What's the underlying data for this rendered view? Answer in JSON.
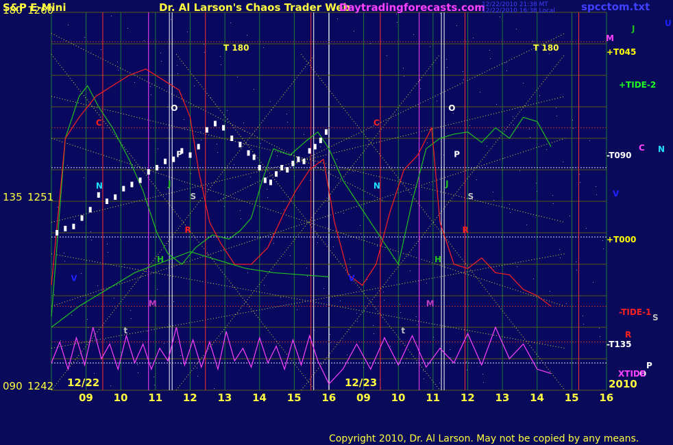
{
  "chart_data": {
    "type": "line",
    "title_left": "S&P E-Mini",
    "title_center": "Dr. Al Larson's Chaos Trader Web",
    "title_site": "Daytradingforecasts.com",
    "timestamp_1": "12/22/2010 21:38 MT",
    "timestamp_2": "12/22/2010 16:38 Local",
    "filename": "spcctom.txt",
    "copyright": "Copyright 2010, Dr. Al Larson. May not be copied by any means.",
    "y_axis": {
      "range": [
        1242,
        1260
      ],
      "labels": [
        {
          "angle": "180",
          "price": "1260",
          "value": 1260
        },
        {
          "angle": "135",
          "price": "1251",
          "value": 1251
        },
        {
          "angle": "090",
          "price": "1242",
          "value": 1242
        }
      ]
    },
    "x_axis": {
      "session_1_ticks": [
        "09",
        "10",
        "11",
        "12",
        "13",
        "14",
        "15",
        "16"
      ],
      "session_2_ticks": [
        "09",
        "10",
        "11",
        "12",
        "13",
        "14",
        "15",
        "16"
      ],
      "date_1": "12/22",
      "date_2": "12/23",
      "year": "2010"
    },
    "right_labels": [
      {
        "text": "M",
        "color": "#ff40ff"
      },
      {
        "text": "J",
        "color": "#20c020"
      },
      {
        "text": "U",
        "color": "#2020ff"
      },
      {
        "text": "+T045",
        "color": "#ffff00"
      },
      {
        "text": "+TIDE-2",
        "color": "#20ff20"
      },
      {
        "text": "C",
        "color": "#ff40ff"
      },
      {
        "text": "N",
        "color": "#20e0ff"
      },
      {
        "text": "-T090",
        "color": "#ffffff"
      },
      {
        "text": "V",
        "color": "#2020ff"
      },
      {
        "text": "+T000",
        "color": "#ffff00"
      },
      {
        "text": "-TIDE-1",
        "color": "#ff2020"
      },
      {
        "text": "S",
        "color": "#c0c0c0"
      },
      {
        "text": "R",
        "color": "#ff2020"
      },
      {
        "text": "-T135",
        "color": "#ffffff"
      },
      {
        "text": "P",
        "color": "#ffffff"
      },
      {
        "text": "O",
        "color": "#ffffff"
      },
      {
        "text": "XTIDE",
        "color": "#ff40ff"
      }
    ],
    "t180_label": "T   180",
    "price_bars": [
      {
        "x": 0.02,
        "y": 1249.5
      },
      {
        "x": 0.05,
        "y": 1249.7
      },
      {
        "x": 0.08,
        "y": 1249.8
      },
      {
        "x": 0.11,
        "y": 1250.2
      },
      {
        "x": 0.14,
        "y": 1250.6
      },
      {
        "x": 0.17,
        "y": 1251.3
      },
      {
        "x": 0.2,
        "y": 1251.0
      },
      {
        "x": 0.23,
        "y": 1251.2
      },
      {
        "x": 0.26,
        "y": 1251.6
      },
      {
        "x": 0.29,
        "y": 1251.8
      },
      {
        "x": 0.32,
        "y": 1252.0
      },
      {
        "x": 0.35,
        "y": 1252.4
      },
      {
        "x": 0.38,
        "y": 1252.6
      },
      {
        "x": 0.41,
        "y": 1252.9
      },
      {
        "x": 0.44,
        "y": 1253.0
      },
      {
        "x": 0.47,
        "y": 1253.4
      },
      {
        "x": 0.5,
        "y": 1253.2
      },
      {
        "x": 0.53,
        "y": 1253.6
      },
      {
        "x": 0.56,
        "y": 1254.4
      },
      {
        "x": 0.59,
        "y": 1254.7
      },
      {
        "x": 0.62,
        "y": 1254.5
      },
      {
        "x": 0.65,
        "y": 1254.0
      },
      {
        "x": 0.68,
        "y": 1253.7
      },
      {
        "x": 0.71,
        "y": 1253.3
      },
      {
        "x": 0.73,
        "y": 1253.1
      },
      {
        "x": 0.75,
        "y": 1252.6
      },
      {
        "x": 0.77,
        "y": 1252.0
      },
      {
        "x": 0.79,
        "y": 1251.9
      },
      {
        "x": 0.81,
        "y": 1252.3
      },
      {
        "x": 0.83,
        "y": 1252.6
      },
      {
        "x": 0.85,
        "y": 1252.5
      },
      {
        "x": 0.87,
        "y": 1252.8
      },
      {
        "x": 0.89,
        "y": 1253.0
      },
      {
        "x": 0.91,
        "y": 1252.9
      },
      {
        "x": 0.93,
        "y": 1253.4
      },
      {
        "x": 0.95,
        "y": 1253.6
      },
      {
        "x": 0.97,
        "y": 1253.9
      },
      {
        "x": 0.99,
        "y": 1254.3
      }
    ],
    "series": [
      {
        "color": "#20c020",
        "points": [
          [
            0.0,
            1245.5
          ],
          [
            0.05,
            1254.0
          ],
          [
            0.1,
            1256.0
          ],
          [
            0.13,
            1256.5
          ],
          [
            0.17,
            1255.5
          ],
          [
            0.22,
            1254.5
          ],
          [
            0.28,
            1253.0
          ],
          [
            0.33,
            1251.5
          ],
          [
            0.38,
            1249.5
          ],
          [
            0.42,
            1248.5
          ],
          [
            0.47,
            1248.0
          ],
          [
            0.52,
            1248.8
          ],
          [
            0.58,
            1249.4
          ],
          [
            0.64,
            1249.2
          ],
          [
            0.68,
            1249.6
          ],
          [
            0.72,
            1250.2
          ],
          [
            0.76,
            1252.0
          ],
          [
            0.8,
            1253.5
          ],
          [
            0.86,
            1253.2
          ],
          [
            0.92,
            1253.9
          ],
          [
            0.96,
            1254.3
          ],
          [
            1.0,
            1253.5
          ],
          [
            1.05,
            1252.0
          ],
          [
            1.1,
            1251.0
          ],
          [
            1.15,
            1250.0
          ],
          [
            1.2,
            1249.0
          ],
          [
            1.25,
            1248.0
          ],
          [
            1.3,
            1251.0
          ],
          [
            1.35,
            1253.5
          ],
          [
            1.4,
            1254.0
          ],
          [
            1.45,
            1254.2
          ],
          [
            1.5,
            1254.3
          ],
          [
            1.55,
            1253.8
          ],
          [
            1.6,
            1254.5
          ],
          [
            1.65,
            1254.0
          ],
          [
            1.7,
            1255.0
          ],
          [
            1.75,
            1254.8
          ],
          [
            1.8,
            1253.6
          ]
        ]
      },
      {
        "color": "#ff2020",
        "points": [
          [
            0.0,
            1247.0
          ],
          [
            0.05,
            1254.0
          ],
          [
            0.1,
            1255.0
          ],
          [
            0.16,
            1256.0
          ],
          [
            0.22,
            1256.5
          ],
          [
            0.28,
            1257.0
          ],
          [
            0.34,
            1257.3
          ],
          [
            0.4,
            1256.8
          ],
          [
            0.46,
            1256.3
          ],
          [
            0.5,
            1255.0
          ],
          [
            0.53,
            1252.5
          ],
          [
            0.57,
            1250.0
          ],
          [
            0.61,
            1249.0
          ],
          [
            0.66,
            1248.0
          ],
          [
            0.72,
            1248.0
          ],
          [
            0.78,
            1248.8
          ],
          [
            0.84,
            1250.5
          ],
          [
            0.88,
            1251.5
          ],
          [
            0.93,
            1252.5
          ],
          [
            0.98,
            1253.0
          ],
          [
            1.02,
            1250.0
          ],
          [
            1.07,
            1247.5
          ],
          [
            1.12,
            1247.0
          ],
          [
            1.17,
            1248.0
          ],
          [
            1.22,
            1250.5
          ],
          [
            1.27,
            1252.5
          ],
          [
            1.32,
            1253.2
          ],
          [
            1.37,
            1254.5
          ],
          [
            1.4,
            1250.0
          ],
          [
            1.45,
            1248.0
          ],
          [
            1.5,
            1247.8
          ],
          [
            1.55,
            1248.3
          ],
          [
            1.6,
            1247.6
          ],
          [
            1.65,
            1247.5
          ],
          [
            1.7,
            1246.8
          ],
          [
            1.75,
            1246.5
          ],
          [
            1.8,
            1246.0
          ]
        ]
      },
      {
        "color": "#ff40ff",
        "points": [
          [
            0.0,
            1243.3
          ],
          [
            0.03,
            1244.3
          ],
          [
            0.06,
            1243.0
          ],
          [
            0.09,
            1244.5
          ],
          [
            0.12,
            1243.2
          ],
          [
            0.15,
            1245.0
          ],
          [
            0.18,
            1243.5
          ],
          [
            0.21,
            1244.2
          ],
          [
            0.24,
            1243.0
          ],
          [
            0.27,
            1244.6
          ],
          [
            0.3,
            1243.3
          ],
          [
            0.33,
            1244.2
          ],
          [
            0.36,
            1243.0
          ],
          [
            0.39,
            1244.0
          ],
          [
            0.42,
            1243.4
          ],
          [
            0.45,
            1245.0
          ],
          [
            0.48,
            1243.2
          ],
          [
            0.51,
            1244.4
          ],
          [
            0.54,
            1243.1
          ],
          [
            0.57,
            1244.3
          ],
          [
            0.6,
            1243.0
          ],
          [
            0.63,
            1244.8
          ],
          [
            0.66,
            1243.4
          ],
          [
            0.69,
            1244.0
          ],
          [
            0.72,
            1243.1
          ],
          [
            0.75,
            1244.5
          ],
          [
            0.78,
            1243.3
          ],
          [
            0.81,
            1244.1
          ],
          [
            0.84,
            1243.0
          ],
          [
            0.87,
            1244.4
          ],
          [
            0.9,
            1243.2
          ],
          [
            0.93,
            1244.6
          ],
          [
            0.96,
            1243.4
          ],
          [
            1.0,
            1242.3
          ],
          [
            1.05,
            1243.0
          ],
          [
            1.1,
            1244.2
          ],
          [
            1.15,
            1243.0
          ],
          [
            1.2,
            1244.5
          ],
          [
            1.25,
            1243.2
          ],
          [
            1.3,
            1244.6
          ],
          [
            1.35,
            1243.1
          ],
          [
            1.4,
            1244.0
          ],
          [
            1.45,
            1243.3
          ],
          [
            1.5,
            1244.7
          ],
          [
            1.55,
            1243.2
          ],
          [
            1.6,
            1245.0
          ],
          [
            1.65,
            1243.5
          ],
          [
            1.7,
            1244.2
          ],
          [
            1.75,
            1243.0
          ],
          [
            1.8,
            1242.8
          ]
        ]
      },
      {
        "color": "#20c020",
        "points": [
          [
            0.0,
            1245.0
          ],
          [
            0.1,
            1246.0
          ],
          [
            0.2,
            1246.8
          ],
          [
            0.3,
            1247.6
          ],
          [
            0.4,
            1248.1
          ],
          [
            0.5,
            1248.6
          ],
          [
            0.6,
            1248.2
          ],
          [
            0.7,
            1247.8
          ],
          [
            0.8,
            1247.6
          ],
          [
            0.9,
            1247.5
          ],
          [
            1.0,
            1247.4
          ]
        ]
      }
    ],
    "event_markers": [
      {
        "text": "C",
        "color": "#ff2020"
      },
      {
        "text": "N",
        "color": "#20e0ff"
      },
      {
        "text": "O",
        "color": "#ffffff"
      },
      {
        "text": "P",
        "color": "#ffffff"
      },
      {
        "text": "S",
        "color": "#c0c0c0"
      },
      {
        "text": "R",
        "color": "#ff2020"
      },
      {
        "text": "H",
        "color": "#20c020"
      },
      {
        "text": "V",
        "color": "#2020ff"
      },
      {
        "text": "M",
        "color": "#c040c0"
      },
      {
        "text": "t",
        "color": "#c0c0c0"
      },
      {
        "text": "J",
        "color": "#20c020"
      }
    ]
  }
}
